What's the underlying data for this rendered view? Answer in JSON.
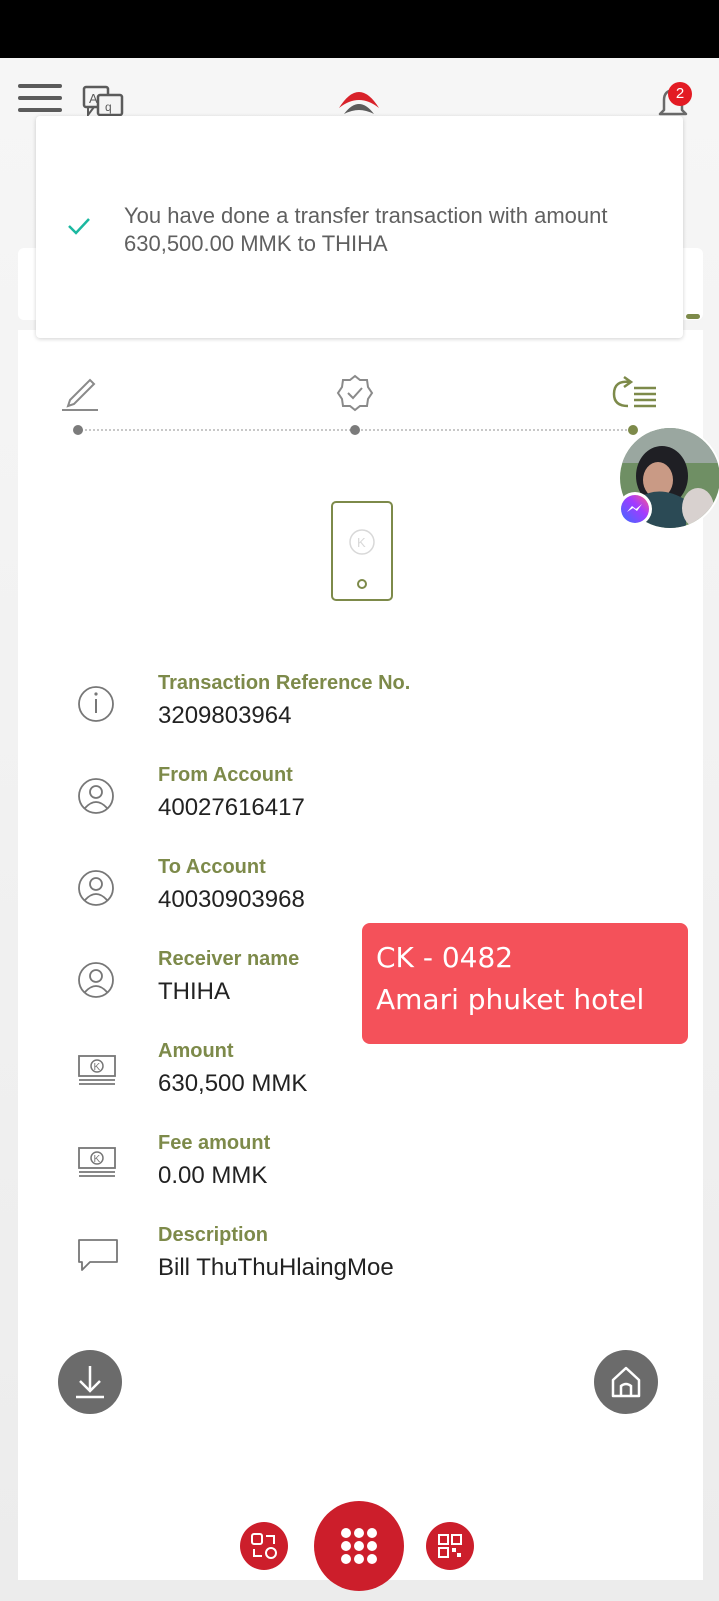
{
  "header": {
    "notification_count": "2",
    "brand_color": "#d8222a",
    "accent_green": "#7d8a4a"
  },
  "toast": {
    "message": "You have done a transfer transaction with amount 630,500.00 MMK to THIHA"
  },
  "steps": [
    {
      "icon": "pencil-icon",
      "state": "done"
    },
    {
      "icon": "verified-badge-icon",
      "state": "done"
    },
    {
      "icon": "transfer-list-icon",
      "state": "current"
    }
  ],
  "details": [
    {
      "label": "Transaction Reference No.",
      "value": "3209803964",
      "icon": "info-icon"
    },
    {
      "label": "From Account",
      "value": "40027616417",
      "icon": "user-circle-icon"
    },
    {
      "label": "To Account",
      "value": "40030903968",
      "icon": "user-circle-icon"
    },
    {
      "label": "Receiver name",
      "value": "THIHA",
      "icon": "user-circle-icon"
    },
    {
      "label": "Amount",
      "value": "630,500 MMK",
      "icon": "banknote-icon"
    },
    {
      "label": "Fee amount",
      "value": "0.00 MMK",
      "icon": "banknote-icon"
    },
    {
      "label": "Description",
      "value": "Bill ThuThuHlaingMoe",
      "icon": "message-icon"
    }
  ],
  "sticker": {
    "line1": "CK - 0482",
    "line2": "Amari phuket hotel"
  }
}
